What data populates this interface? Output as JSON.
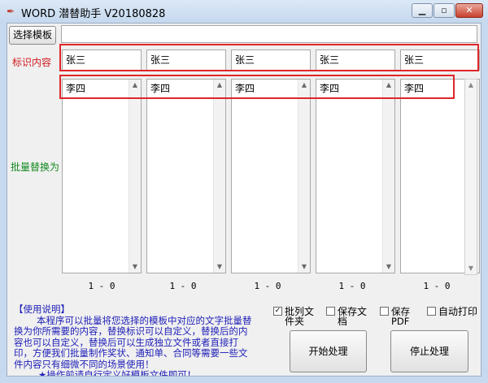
{
  "window": {
    "title": "WORD 潜替助手 V20180828",
    "controls": {
      "minimize": "▁",
      "maximize": "▫",
      "close": "✕"
    },
    "icon": "feather-icon"
  },
  "template": {
    "button_label": "选择模板",
    "path_value": ""
  },
  "labels": {
    "identify_content": "标识内容",
    "batch_replace": "批量替换为"
  },
  "identify_fields": [
    "张三",
    "张三",
    "张三",
    "张三",
    "张三"
  ],
  "replace_fields": [
    "李四",
    "李四",
    "李四",
    "李四",
    "李四"
  ],
  "counts": [
    "1 - 0",
    "1 - 0",
    "1 - 0",
    "1 - 0",
    "1 - 0"
  ],
  "help": {
    "title": "【使用说明】",
    "lines": [
      "本程序可以批量将您选择的模板中对应的文字批量替",
      "换为你所需要的内容，替换标识可以自定义，替换后的内",
      "容也可以自定义，替换后可以生成独立文件或者直接打",
      "印，方便我们批量制作奖状、通知单、合同等需要一些文",
      "件内容只有细微不同的场景使用！",
      "★操作前请自行定义好模板文件即可！"
    ]
  },
  "options": {
    "batch_files": {
      "label": "批列文件夹",
      "checked": true
    },
    "save_doc": {
      "label": "保存文档",
      "checked": false
    },
    "save_pdf": {
      "label": "保存PDF",
      "checked": false
    },
    "auto_print": {
      "label": "自动打印",
      "checked": false
    }
  },
  "actions": {
    "start": "开始处理",
    "stop": "停止处理"
  }
}
